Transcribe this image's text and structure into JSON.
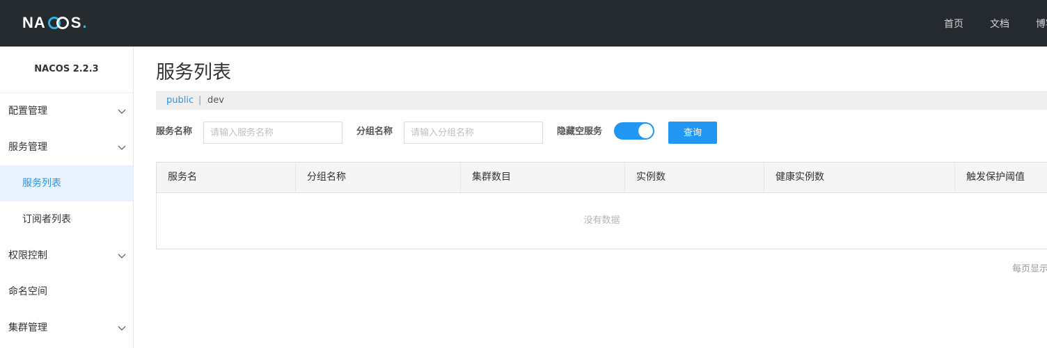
{
  "header": {
    "logo_text": "NACOS.",
    "nav": [
      "首页",
      "文档",
      "博客"
    ]
  },
  "sidebar": {
    "version": "NACOS 2.2.3",
    "items": [
      {
        "label": "配置管理",
        "expandable": true
      },
      {
        "label": "服务管理",
        "expandable": true,
        "expanded": true
      },
      {
        "label": "服务列表",
        "sub": true,
        "active": true
      },
      {
        "label": "订阅者列表",
        "sub": true
      },
      {
        "label": "权限控制",
        "expandable": true
      },
      {
        "label": "命名空间"
      },
      {
        "label": "集群管理",
        "expandable": true
      }
    ]
  },
  "main": {
    "title": "服务列表",
    "namespace": {
      "current": "public",
      "separator": "|",
      "other": "dev"
    },
    "filters": {
      "service_name_label": "服务名称",
      "service_name_placeholder": "请输入服务名称",
      "group_name_label": "分组名称",
      "group_name_placeholder": "请输入分组名称",
      "hide_empty_label": "隐藏空服务",
      "hide_empty_on": true,
      "query_button": "查询"
    },
    "table": {
      "columns": [
        "服务名",
        "分组名称",
        "集群数目",
        "实例数",
        "健康实例数",
        "触发保护阈值"
      ],
      "rows": [],
      "empty_text": "没有数据"
    },
    "pager_text": "每页显示"
  },
  "colors": {
    "header_bg": "#252a2f",
    "accent": "#2196f3",
    "active_bg": "#e8f3fd"
  }
}
